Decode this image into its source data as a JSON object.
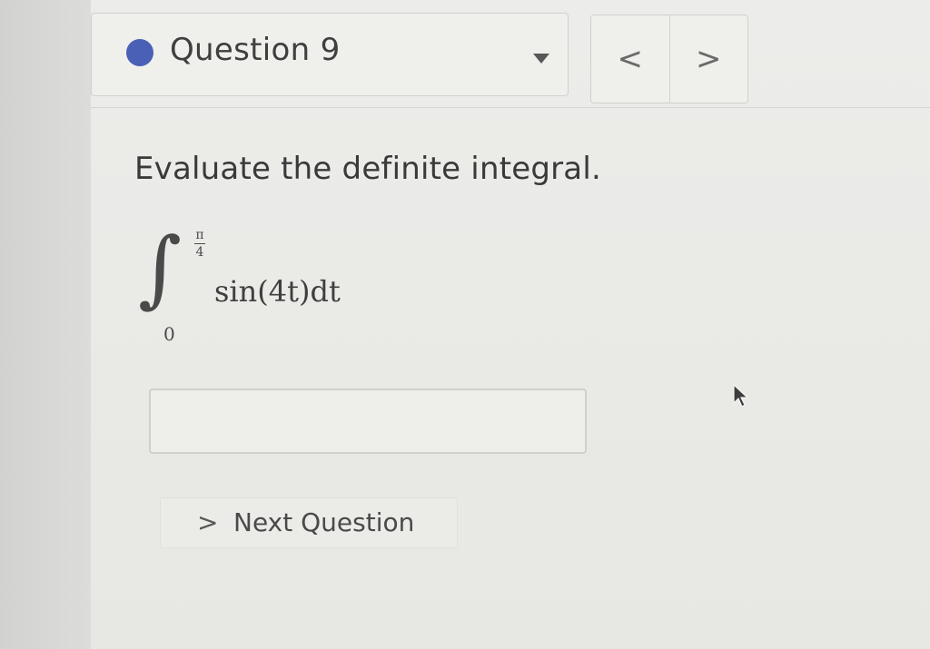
{
  "header": {
    "question_label": "Question 9",
    "status_dot_color": "#4a5fb6",
    "dropdown_icon": "caret-down-icon",
    "nav": {
      "prev_glyph": "<",
      "next_glyph": ">"
    }
  },
  "question": {
    "prompt": "Evaluate the definite integral.",
    "integral": {
      "sign": "∫",
      "upper_numerator": "π",
      "upper_denominator": "4",
      "lower_limit": "0",
      "integrand": "sin(4t)dt"
    }
  },
  "answer": {
    "value": "",
    "placeholder": ""
  },
  "footer": {
    "next_chevron": ">",
    "next_label": "Next Question"
  },
  "colors": {
    "accent": "#4a5fb6",
    "text": "#3a3a3a",
    "panel": "#ecece9"
  }
}
